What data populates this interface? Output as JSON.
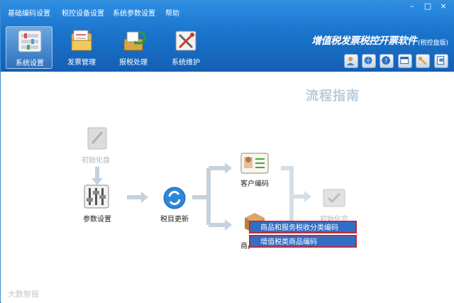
{
  "menubar": {
    "items": [
      "基础编码设置",
      "税控设备设置",
      "系统参数设置",
      "帮助"
    ],
    "window_controls": [
      "–",
      "□",
      "×"
    ]
  },
  "toolbar": {
    "items": [
      {
        "label": "系统设置",
        "icon": "settings-panel-icon",
        "active": true
      },
      {
        "label": "发票管理",
        "icon": "invoice-folder-icon",
        "active": false
      },
      {
        "label": "报税处理",
        "icon": "tax-report-icon",
        "active": false
      },
      {
        "label": "系统维护",
        "icon": "maintenance-tools-icon",
        "active": false
      }
    ],
    "quick_buttons": [
      "user-icon",
      "network-icon",
      "help-icon",
      "window-icon",
      "key-icon",
      "exit-icon"
    ]
  },
  "app": {
    "title": "增值税发票税控开票软件",
    "subtitle": "(税控盘版)"
  },
  "guide": {
    "title": "流程指南",
    "nodes": {
      "init_disk": "初始化盘",
      "param_settings": "参数设置",
      "tax_catalog_update": "税目更新",
      "customer_code": "客户编码",
      "product_code": "商品编码",
      "init_done": "初始化完"
    }
  },
  "context_menu": {
    "items": [
      "商品和服务税收分类编码",
      "增值税类商品编码"
    ]
  },
  "watermark": "大数智报",
  "colors": {
    "header_blue": "#1a74cc",
    "menu_highlight": "#2f6fc6",
    "menu_border": "#c12a3a",
    "guide_title": "#bccbd8"
  }
}
